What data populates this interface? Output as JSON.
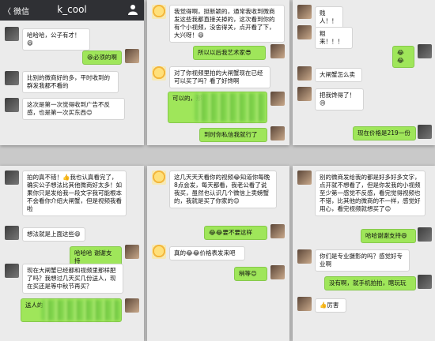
{
  "colors": {
    "nav_bg": "#2f3034",
    "chat_bg": "#ebebeb",
    "green_bubble": "#9fe65a",
    "white_bubble": "#ffffff"
  },
  "shot1": {
    "time": "",
    "back_label": "〈 微信",
    "title": "k_cool",
    "m1": "哈哈哈，公子有才！😄",
    "m2": "😆必须的啊",
    "m3": "比别的微商好的多，平时收到的群发我都不看的",
    "m4": "这次是第一次觉得收到广告不反感，也是第一次买东西😊"
  },
  "shot2": {
    "m1": "我觉得啊，挺新颖的，通常我收到微商发这些我都直接关掉的，这次看到你的有个小视频，没舍得关，点开看了下，大兴呀！😄",
    "m2": "所以以后我艺术家😎",
    "m3": "对了你视频里拍的大闸蟹现在已经可以买了吗？看了好馋啊",
    "m4": "可以的，那",
    "m5": "到时你私信我就行了"
  },
  "shot3": {
    "m1": "贱人！！",
    "m2": "粗来！！！",
    "m3": "😂😂",
    "m4": "大闸蟹怎么卖",
    "m5": "把我馋得了！😢",
    "m6": "现在价格是219一份"
  },
  "shot4": {
    "m1": "拍的真不错！👍我也认真看完了，确实公子想法比其他微商好太多！如果你只是发给我一段文字我可能根本不会看你介绍大闸蟹，但是视频我看啦",
    "m2": "想法就是上面这些😄",
    "m3": "哈哈哈 谢谢支持",
    "m4": "现在大闸蟹已经都和视频里那样肥了吗？我想过几天买几份送人，现在买还是等中秋节再买？",
    "m5": "送人的"
  },
  "shot5": {
    "m1": "这几天天天看你的视频😂知道你每晚8点会发，每天都看，我老公看了说我买，虽然也认识几个微信上卖螃蟹的，我就是买了你家的😊",
    "m2": "😂😂要不要这样",
    "m3": "真的😂😂价格表发来吧",
    "m4": "稍等😊"
  },
  "shot6": {
    "m1": "别的微商发给我的都是好多好多文字，点开就不想看了，但是你发我的小视频至少第一感觉不反感，看完觉得视频也不错，比其他的微商的不一样，感觉好用心，看完视频就想买了😊",
    "m2": "哈哈谢谢支持😄",
    "m3": "你们是专业摄影的吗？感觉好专业啊",
    "m4": "没有啊，就手机拍拍，瞎玩玩",
    "m5": "👍厉害"
  }
}
